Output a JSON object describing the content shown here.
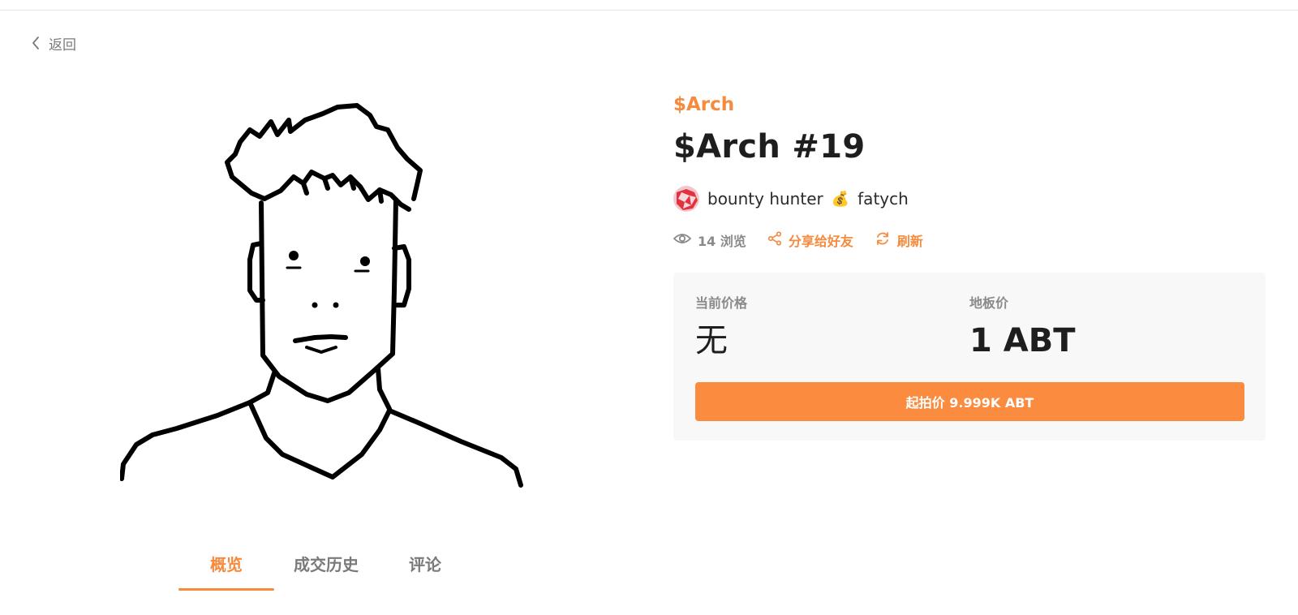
{
  "nav": {
    "back_label": "返回",
    "back_icon": "chevron-left-icon"
  },
  "artwork": {
    "alt": "line drawing portrait"
  },
  "nft": {
    "collection": "$Arch",
    "title": "$Arch #19",
    "owner": {
      "name": "bounty hunter",
      "emoji": "💰",
      "suffix": "fatych"
    },
    "stats": {
      "views": "14 浏览",
      "share_label": "分享给好友",
      "refresh_label": "刷新"
    },
    "pricing": {
      "current_price_label": "当前价格",
      "current_price_value": "无",
      "floor_price_label": "地板价",
      "floor_price_value": "1 ABT",
      "bid_button_label": "起拍价 9.999K ABT"
    }
  },
  "tabs": [
    {
      "label": "概览",
      "active": true
    },
    {
      "label": "成交历史",
      "active": false
    },
    {
      "label": "评论",
      "active": false
    }
  ],
  "colors": {
    "accent": "#f68a3d",
    "button": "#fb8b3e",
    "panel": "#f8f8f8",
    "muted": "#8a8a8a"
  }
}
